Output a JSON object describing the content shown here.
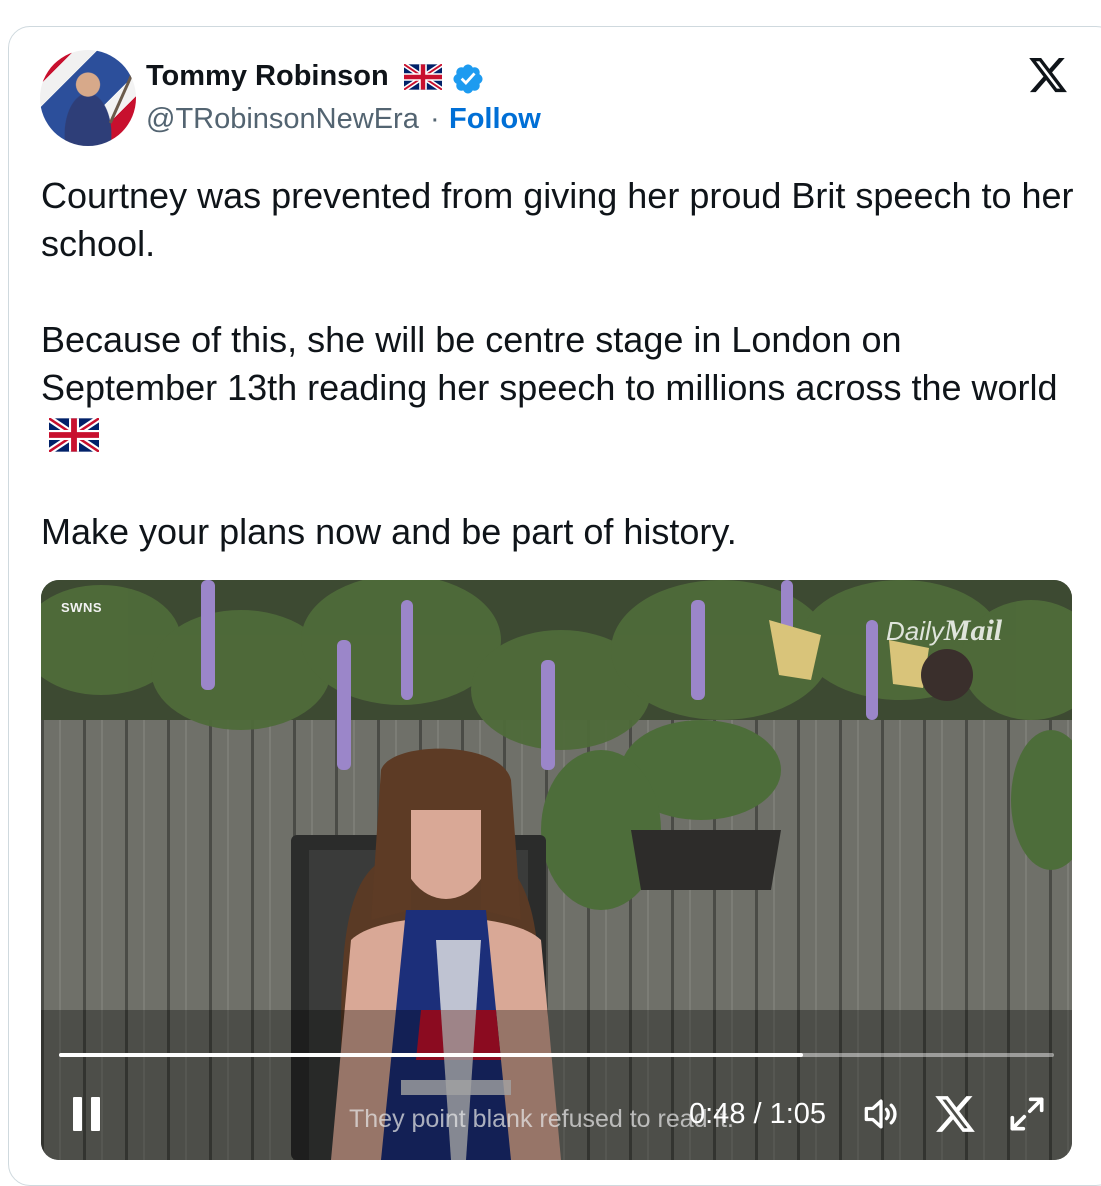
{
  "author": {
    "name": "Tommy Robinson",
    "handle": "@TRobinsonNewEra",
    "separator": "·",
    "follow_label": "Follow"
  },
  "tweet": {
    "paragraphs": [
      "Courtney was prevented from giving her proud Brit speech to her school.",
      "Because of this, she will be centre stage in London on September 13th reading her speech to millions across the world",
      "Make your plans now and be part of history."
    ]
  },
  "video": {
    "watermark_left": "SWNS",
    "watermark_right_a": "Daily",
    "watermark_right_b": "Mail",
    "caption": "They point blank refused to read it.",
    "time_display": "0:48 / 1:05",
    "progress": 0.748
  },
  "icons": {
    "x_logo": "x-logo-icon",
    "verified": "verified-badge-icon",
    "uk_flag": "uk-flag-icon",
    "pause": "pause-icon",
    "volume": "volume-icon",
    "fullscreen": "fullscreen-icon"
  },
  "colors": {
    "text": "#0f1419",
    "muted": "#536471",
    "link": "#006fd6",
    "verified": "#1d9bf0"
  }
}
